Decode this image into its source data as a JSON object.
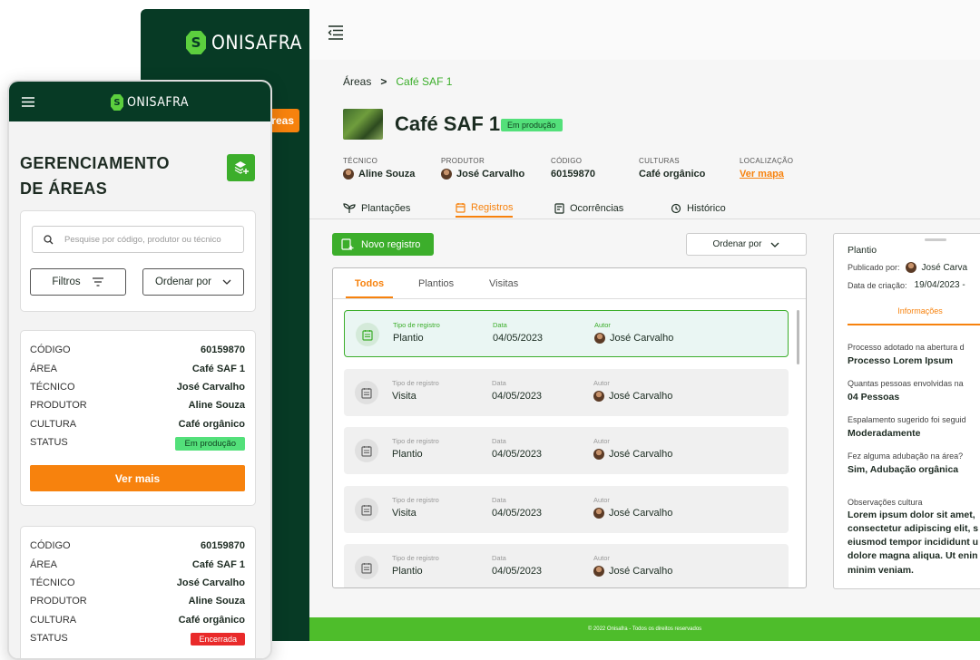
{
  "brand": {
    "name": "ONISAFRA",
    "accent": "#3cae2b",
    "orange": "#f7820d",
    "dark_green": "#073a25"
  },
  "desktop": {
    "sidebar_active_label": "Áreas",
    "sidebar_active_visible": "reas",
    "breadcrumb": {
      "root": "Áreas",
      "separator": ">",
      "current": "Café SAF 1"
    },
    "area": {
      "title": "Café SAF 1",
      "status": "Em produção"
    },
    "meta": [
      {
        "label": "TÉCNICO",
        "value": "Aline Souza"
      },
      {
        "label": "PRODUTOR",
        "value": "José Carvalho"
      },
      {
        "label": "CÓDIGO",
        "value": "60159870"
      },
      {
        "label": "CULTURAS",
        "value": "Café orgânico"
      },
      {
        "label": "LOCALIZAÇÃO",
        "value": "Ver mapa"
      }
    ],
    "tabs": [
      "Plantações",
      "Registros",
      "Ocorrências",
      "Histórico"
    ],
    "new_record": "Novo registro",
    "order_by": "Ordenar por",
    "sub_tabs": [
      "Todos",
      "Plantios",
      "Visitas"
    ],
    "field_labels": {
      "type": "Tipo de registro",
      "date": "Data",
      "author": "Autor"
    },
    "records": [
      {
        "type": "Plantio",
        "date": "04/05/2023",
        "author": "José Carvalho"
      },
      {
        "type": "Visita",
        "date": "04/05/2023",
        "author": "José Carvalho"
      },
      {
        "type": "Plantio",
        "date": "04/05/2023",
        "author": "José Carvalho"
      },
      {
        "type": "Visita",
        "date": "04/05/2023",
        "author": "José Carvalho"
      },
      {
        "type": "Plantio",
        "date": "04/05/2023",
        "author": "José Carvalho"
      }
    ],
    "detail": {
      "title": "Plantio",
      "published_label": "Publicado por:",
      "published_value": "José Carva",
      "created_label": "Data de criação:",
      "created_value": "19/04/2023 -",
      "tab": "Informações",
      "qa": [
        {
          "q": "Processo adotado na abertura d",
          "a": "Processo Lorem Ipsum"
        },
        {
          "q": "Quantas pessoas envolvidas na",
          "a": "04 Pessoas"
        },
        {
          "q": "Espalamento sugerido foi seguid",
          "a": "Moderadamente"
        },
        {
          "q": "Fez alguma adubação na área?",
          "a": "Sim, Adubação orgânica"
        }
      ],
      "notes_label": "Observações cultura",
      "notes_lines": [
        "Lorem ipsum dolor sit amet,",
        "consectetur adipiscing elit, s",
        "eiusmod tempor incididunt u",
        "dolore magna aliqua. Ut enin",
        "minim veniam."
      ]
    },
    "footer": "© 2022 Onisafra -  Todos os direitos reservados"
  },
  "mobile": {
    "title_line1": "GERENCIAMENTO",
    "title_line2": "DE ÁREAS",
    "search_placeholder": "Pesquise por código, produtor ou técnico",
    "filters": "Filtros",
    "order_by": "Ordenar por",
    "labels": {
      "code": "CÓDIGO",
      "area": "ÁREA",
      "tech": "TÉCNICO",
      "producer": "PRODUTOR",
      "culture": "CULTURA",
      "status": "STATUS"
    },
    "cards": [
      {
        "code": "60159870",
        "area": "Café SAF 1",
        "tech": "José Carvalho",
        "producer": "Aline Souza",
        "culture": "Café orgânico",
        "status": "Em produção",
        "more": "Ver mais"
      },
      {
        "code": "60159870",
        "area": "Café SAF 1",
        "tech": "José Carvalho",
        "producer": "Aline Souza",
        "culture": "Café orgânico",
        "status": "Encerrada"
      }
    ]
  }
}
